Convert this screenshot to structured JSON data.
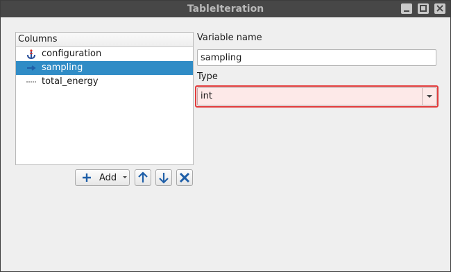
{
  "window": {
    "title": "TableIteration",
    "controls": [
      "minimize-icon",
      "maximize-icon",
      "close-icon"
    ]
  },
  "columns": {
    "header": "Columns",
    "items": [
      {
        "label": "configuration",
        "icon": "anchor-icon",
        "selected": false
      },
      {
        "label": "sampling",
        "icon": "arrow-right-icon",
        "selected": true
      },
      {
        "label": "total_energy",
        "icon": "dotted-line-icon",
        "selected": false
      }
    ]
  },
  "toolbar": {
    "add_label": "Add",
    "move_up_icon": "arrow-up-icon",
    "move_down_icon": "arrow-down-icon",
    "remove_icon": "remove-x-icon"
  },
  "form": {
    "variable_name_label": "Variable name",
    "variable_name_value": "sampling",
    "type_label": "Type",
    "type_value": "int"
  },
  "colors": {
    "selection": "#308cc6",
    "highlight_border": "#e23b3b",
    "icon_blue": "#1f5fa8"
  }
}
